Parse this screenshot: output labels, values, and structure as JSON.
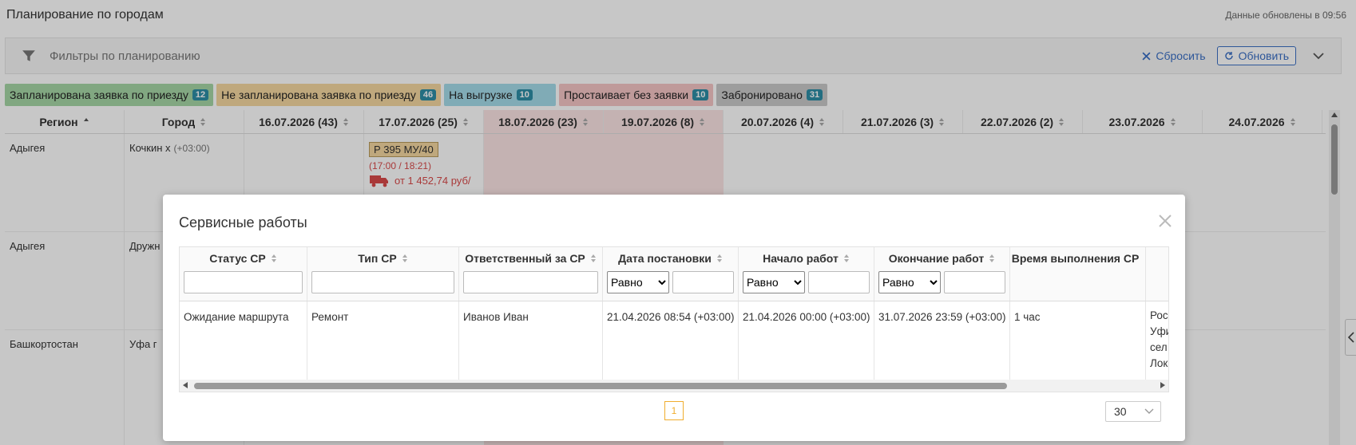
{
  "header": {
    "title": "Планирование по городам",
    "updated": "Данные обновлены в 09:56"
  },
  "filters": {
    "label": "Фильтры по планированию",
    "reset": "Сбросить",
    "refresh": "Обновить"
  },
  "legend": [
    {
      "label": "Запланирована заявка по приезду",
      "count": "12",
      "color": "#a6d6a6"
    },
    {
      "label": "Не запланирована заявка по приезду",
      "count": "46",
      "color": "#f5d8a0"
    },
    {
      "label": "На выгрузке",
      "count": "10",
      "color": "#a5dce9"
    },
    {
      "label": "Простаивает без заявки",
      "count": "10",
      "color": "#f5c6c6"
    },
    {
      "label": "Забронировано",
      "count": "31",
      "color": "#c9c9c9"
    }
  ],
  "grid": {
    "columns": [
      "Регион",
      "Город",
      "16.07.2026 (43)",
      "17.07.2026 (25)",
      "18.07.2026 (23)",
      "19.07.2026 (8)",
      "20.07.2026 (4)",
      "21.07.2026 (3)",
      "22.07.2026 (2)",
      "23.07.2026",
      "24.07.2026"
    ],
    "rows": [
      {
        "region": "Адыгея",
        "city": "Кочкин х",
        "tz": "(+03:00)",
        "plate": "Р 395 МУ/40",
        "time": "(17:00 / 18:21)",
        "price": "от 1 452,74 руб/"
      },
      {
        "region": "Адыгея",
        "city": "Дружн"
      },
      {
        "region": "Башкортостан",
        "city": "Уфа г"
      }
    ]
  },
  "modal": {
    "title": "Сервисные работы",
    "columns": [
      "Статус СР",
      "Тип СР",
      "Ответственный за СР",
      "Дата постановки",
      "Начало работ",
      "Окончание работ",
      "Время выполнения СР"
    ],
    "operator": "Равно",
    "row": {
      "status": "Ожидание маршрута",
      "type": "Ремонт",
      "responsible": "Иванов Иван",
      "date_set": "21.04.2026 08:54 (+03:00)",
      "start": "21.04.2026 00:00 (+03:00)",
      "end": "31.07.2026 23:59 (+03:00)",
      "duration": "1 час",
      "extra_lines": [
        "Рос",
        "Уфи",
        "сел",
        "Лок"
      ]
    },
    "page": "1",
    "page_size": "30"
  }
}
